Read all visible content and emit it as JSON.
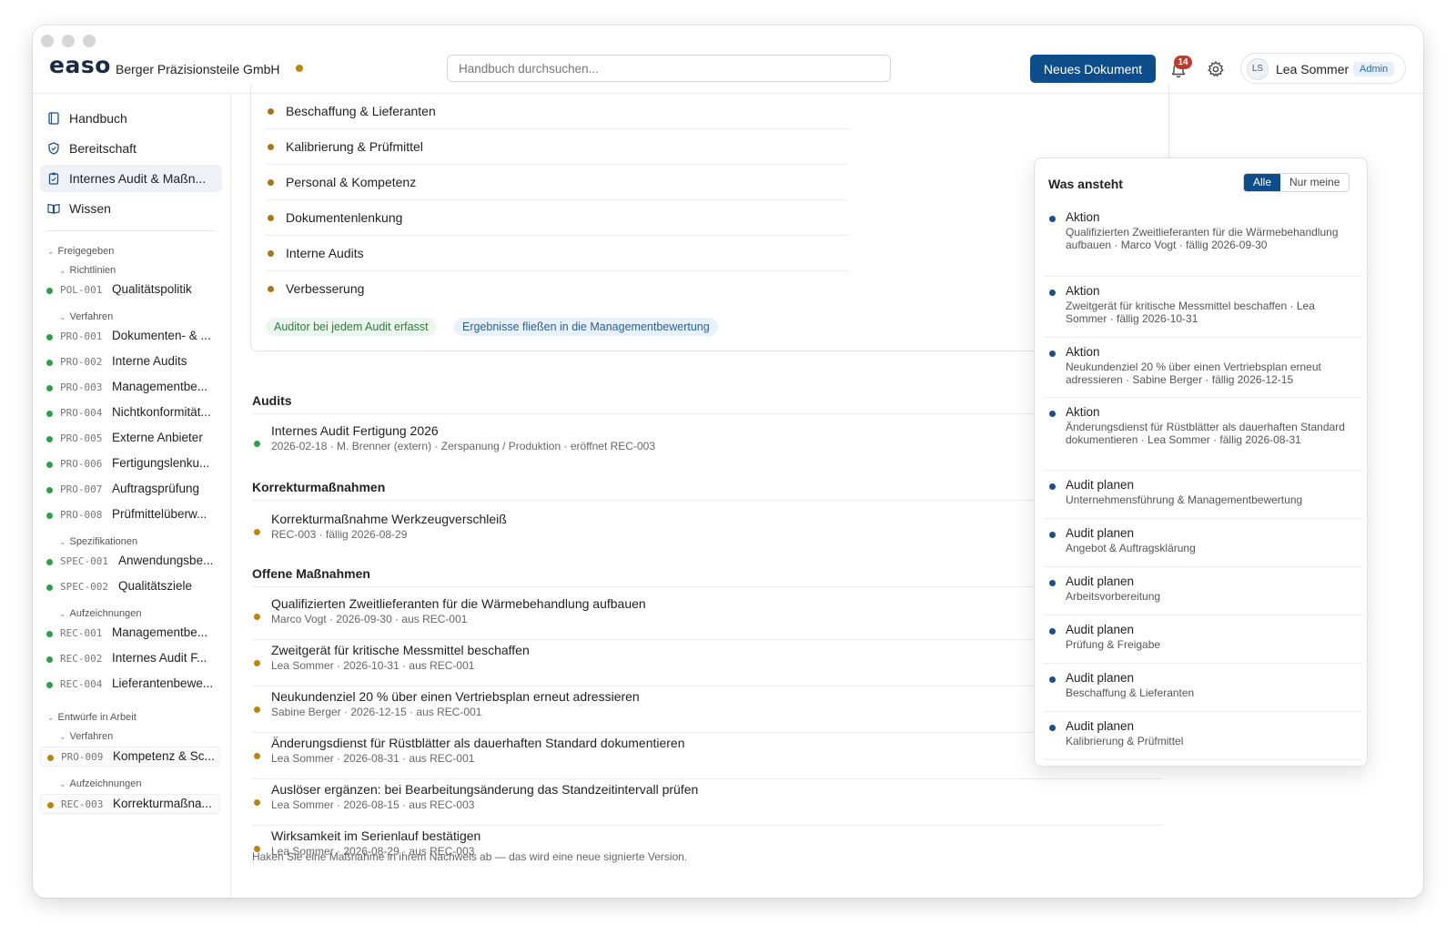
{
  "header": {
    "logo": "easo",
    "company": "Berger Präzisionsteile GmbH",
    "search_placeholder": "Handbuch durchsuchen...",
    "new_document_label": "Neues Dokument",
    "notification_count": "14",
    "user_initials": "LS",
    "user_name": "Lea Sommer",
    "user_role": "Admin"
  },
  "sidebar": {
    "nav": [
      {
        "label": "Handbuch",
        "icon": "book-icon"
      },
      {
        "label": "Bereitschaft",
        "icon": "shield-check-icon"
      },
      {
        "label": "Internes Audit & Maßn...",
        "icon": "clipboard-icon"
      },
      {
        "label": "Wissen",
        "icon": "open-book-icon"
      }
    ],
    "groups": {
      "freigegeben": "Freigegeben",
      "richtlinien": "Richtlinien",
      "verfahren": "Verfahren",
      "spezifikationen": "Spezifikationen",
      "aufzeichnungen": "Aufzeichnungen",
      "entwuerfe": "Entwürfe in Arbeit",
      "verfahren2": "Verfahren",
      "aufzeichnungen2": "Aufzeichnungen"
    },
    "docs": [
      {
        "code": "POL-001",
        "title": "Qualitätspolitik"
      },
      {
        "code": "PRO-001",
        "title": "Dokumenten- & ..."
      },
      {
        "code": "PRO-002",
        "title": "Interne Audits"
      },
      {
        "code": "PRO-003",
        "title": "Managementbe..."
      },
      {
        "code": "PRO-004",
        "title": "Nichtkonformität..."
      },
      {
        "code": "PRO-005",
        "title": "Externe Anbieter"
      },
      {
        "code": "PRO-006",
        "title": "Fertigungslenku..."
      },
      {
        "code": "PRO-007",
        "title": "Auftragsprüfung"
      },
      {
        "code": "PRO-008",
        "title": "Prüfmittelüberw..."
      },
      {
        "code": "SPEC-001",
        "title": "Anwendungsbe..."
      },
      {
        "code": "SPEC-002",
        "title": "Qualitätsziele"
      },
      {
        "code": "REC-001",
        "title": "Managementbe..."
      },
      {
        "code": "REC-002",
        "title": "Internes Audit F..."
      },
      {
        "code": "REC-004",
        "title": "Lieferantenbewe..."
      },
      {
        "code": "PRO-009",
        "title": "Kompetenz & Sc..."
      },
      {
        "code": "REC-003",
        "title": "Korrekturmaßna..."
      }
    ]
  },
  "main": {
    "topics": [
      "Beschaffung & Lieferanten",
      "Kalibrierung & Prüfmittel",
      "Personal & Kompetenz",
      "Dokumentenlenkung",
      "Interne Audits",
      "Verbesserung"
    ],
    "tags": [
      "Auditor bei jedem Audit erfasst",
      "Ergebnisse fließen in die Managementbewertung"
    ],
    "audits_title": "Audits",
    "audits": [
      {
        "title": "Internes Audit Fertigung 2026",
        "meta": "2026-02-18 · M. Brenner (extern) · Zerspanung / Produktion · eröffnet REC-003"
      }
    ],
    "corrections_title": "Korrekturmaßnahmen",
    "corrections": [
      {
        "title": "Korrekturmaßnahme Werkzeugverschleiß",
        "meta": "REC-003 · fällig 2026-08-29"
      }
    ],
    "open_title": "Offene Maßnahmen",
    "open_actions": [
      {
        "title": "Qualifizierten Zweitlieferanten für die Wärmebehandlung aufbauen",
        "meta": "Marco Vogt · 2026-09-30 · aus REC-001"
      },
      {
        "title": "Zweitgerät für kritische Messmittel beschaffen",
        "meta": "Lea Sommer · 2026-10-31 · aus REC-001"
      },
      {
        "title": "Neukundenziel 20 % über einen Vertriebsplan erneut adressieren",
        "meta": "Sabine Berger · 2026-12-15 · aus REC-001"
      },
      {
        "title": "Änderungsdienst für Rüstblätter als dauerhaften Standard dokumentieren",
        "meta": "Lea Sommer · 2026-08-31 · aus REC-001"
      },
      {
        "title": "Auslöser ergänzen: bei Bearbeitungsänderung das Standzeitintervall prüfen",
        "meta": "Lea Sommer · 2026-08-15 · aus REC-003"
      },
      {
        "title": "Wirksamkeit im Serienlauf bestätigen",
        "meta": "Lea Sommer · 2026-08-29 · aus REC-003"
      }
    ],
    "footnote": "Haken Sie eine Maßnahme in ihrem Nachweis ab — das wird eine neue signierte Version."
  },
  "dropdown": {
    "title": "Was ansteht",
    "filter_all": "Alle",
    "filter_mine": "Nur meine",
    "items": [
      {
        "title": "Aktion",
        "desc": "Qualifizierten Zweitlieferanten für die Wärmebehandlung aufbauen · Marco Vogt · fällig 2026-09-30"
      },
      {
        "title": "Aktion",
        "desc": "Zweitgerät für kritische Messmittel beschaffen · Lea Sommer · fällig 2026-10-31"
      },
      {
        "title": "Aktion",
        "desc": "Neukundenziel 20 % über einen Vertriebsplan erneut adressieren · Sabine Berger · fällig 2026-12-15"
      },
      {
        "title": "Aktion",
        "desc": "Änderungsdienst für Rüstblätter als dauerhaften Standard dokumentieren · Lea Sommer · fällig 2026-08-31"
      },
      {
        "title": "Audit planen",
        "desc": "Unternehmensführung & Managementbewertung"
      },
      {
        "title": "Audit planen",
        "desc": "Angebot & Auftragsklärung"
      },
      {
        "title": "Audit planen",
        "desc": "Arbeitsvorbereitung"
      },
      {
        "title": "Audit planen",
        "desc": "Prüfung & Freigabe"
      },
      {
        "title": "Audit planen",
        "desc": "Beschaffung & Lieferanten"
      },
      {
        "title": "Audit planen",
        "desc": "Kalibrierung & Prüfmittel"
      }
    ]
  },
  "colors": {
    "brand": "#0d4d8c",
    "released": "#2e9e4a",
    "draft": "#b8860b",
    "open": "#a8761a",
    "badge": "#c0392b"
  }
}
